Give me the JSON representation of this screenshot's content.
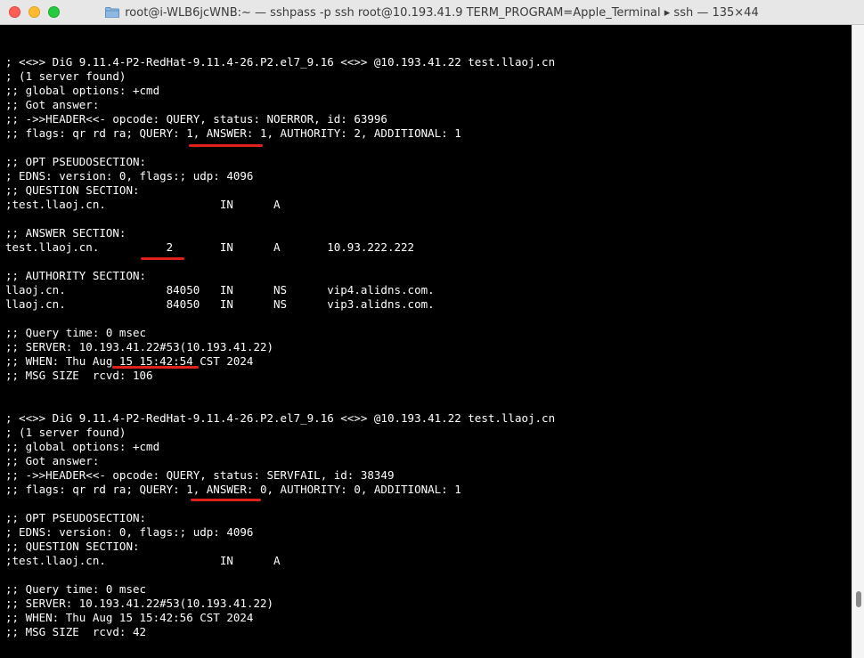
{
  "window": {
    "title": "root@i-WLB6jcWNB:~ — sshpass -p ssh root@10.193.41.9 TERM_PROGRAM=Apple_Terminal ▸ ssh — 135×44",
    "icon": "folder-icon"
  },
  "terminal": {
    "lines": [
      "; <<>> DiG 9.11.4-P2-RedHat-9.11.4-26.P2.el7_9.16 <<>> @10.193.41.22 test.llaoj.cn",
      "; (1 server found)",
      ";; global options: +cmd",
      ";; Got answer:",
      ";; ->>HEADER<<- opcode: QUERY, status: NOERROR, id: 63996",
      ";; flags: qr rd ra; QUERY: 1, ANSWER: 1, AUTHORITY: 2, ADDITIONAL: 1",
      ";; OPT PSEUDOSECTION:",
      "; EDNS: version: 0, flags:; udp: 4096",
      ";; QUESTION SECTION:",
      ";test.llaoj.cn.                 IN      A",
      ";; ANSWER SECTION:",
      "test.llaoj.cn.          2       IN      A       10.93.222.222",
      ";; AUTHORITY SECTION:",
      "llaoj.cn.               84050   IN      NS      vip4.alidns.com.",
      "llaoj.cn.               84050   IN      NS      vip3.alidns.com.",
      ";; Query time: 0 msec",
      ";; SERVER: 10.193.41.22#53(10.193.41.22)",
      ";; WHEN: Thu Aug 15 15:42:54 CST 2024",
      ";; MSG SIZE  rcvd: 106",
      "; <<>> DiG 9.11.4-P2-RedHat-9.11.4-26.P2.el7_9.16 <<>> @10.193.41.22 test.llaoj.cn",
      "; (1 server found)",
      ";; global options: +cmd",
      ";; Got answer:",
      ";; ->>HEADER<<- opcode: QUERY, status: SERVFAIL, id: 38349",
      ";; flags: qr rd ra; QUERY: 1, ANSWER: 0, AUTHORITY: 0, ADDITIONAL: 1",
      ";; OPT PSEUDOSECTION:",
      "; EDNS: version: 0, flags:; udp: 4096",
      ";; QUESTION SECTION:",
      ";test.llaoj.cn.                 IN      A",
      ";; Query time: 0 msec",
      ";; SERVER: 10.193.41.22#53(10.193.41.22)",
      ";; WHEN: Thu Aug 15 15:42:56 CST 2024",
      ";; MSG SIZE  rcvd: 42"
    ]
  },
  "colors": {
    "terminal_bg": "#000000",
    "terminal_fg": "#ffffff",
    "annotation": "#e0211b"
  }
}
